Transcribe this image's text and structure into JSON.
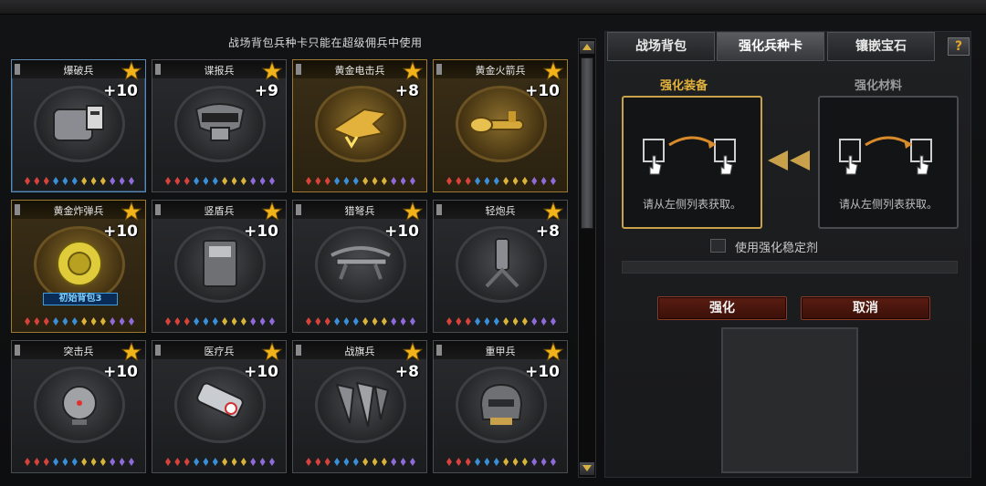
{
  "notice": "战场背包兵种卡只能在超级佣兵中使用",
  "cards": [
    {
      "name": "爆破兵",
      "level": "+10",
      "style": "selected",
      "icon": "explosive-pack-icon",
      "badge": ""
    },
    {
      "name": "谍报兵",
      "level": "+9",
      "style": "normal",
      "icon": "spy-helmet-icon",
      "badge": ""
    },
    {
      "name": "黄金电击兵",
      "level": "+8",
      "style": "gold",
      "icon": "gold-electric-gun-icon",
      "badge": ""
    },
    {
      "name": "黄金火箭兵",
      "level": "+10",
      "style": "gold",
      "icon": "gold-rocket-launcher-icon",
      "badge": ""
    },
    {
      "name": "黄金炸弹兵",
      "level": "+10",
      "style": "gold",
      "icon": "gold-bomb-icon",
      "badge": "初始背包3"
    },
    {
      "name": "竖盾兵",
      "level": "+10",
      "style": "normal",
      "icon": "riot-shield-icon",
      "badge": ""
    },
    {
      "name": "猎弩兵",
      "level": "+10",
      "style": "normal",
      "icon": "crossbow-icon",
      "badge": ""
    },
    {
      "name": "轻炮兵",
      "level": "+8",
      "style": "normal",
      "icon": "mortar-icon",
      "badge": ""
    },
    {
      "name": "突击兵",
      "level": "+10",
      "style": "normal",
      "icon": "assault-device-icon",
      "badge": ""
    },
    {
      "name": "医疗兵",
      "level": "+10",
      "style": "normal",
      "icon": "medkit-icon",
      "badge": ""
    },
    {
      "name": "战旗兵",
      "level": "+8",
      "style": "normal",
      "icon": "war-flags-icon",
      "badge": ""
    },
    {
      "name": "重甲兵",
      "level": "+10",
      "style": "normal",
      "icon": "heavy-armor-helmet-icon",
      "badge": ""
    }
  ],
  "gem_colors": [
    "#d9423b",
    "#d9423b",
    "#d9423b",
    "#3a8fd9",
    "#3a8fd9",
    "#3a8fd9",
    "#d9b33a",
    "#d9b33a",
    "#d9b33a",
    "#8f6ad9",
    "#8f6ad9",
    "#8f6ad9"
  ],
  "tabs": [
    "战场背包",
    "强化兵种卡",
    "镶嵌宝石"
  ],
  "active_tab": 1,
  "help_label": "?",
  "enhance": {
    "equip_label": "强化装备",
    "material_label": "强化材料",
    "hint": "请从左侧列表获取。",
    "stabilizer_label": "使用强化稳定剂",
    "confirm_label": "强化",
    "cancel_label": "取消"
  },
  "colors": {
    "gold_accent": "#e3b23c",
    "star": "#f2b21a"
  }
}
